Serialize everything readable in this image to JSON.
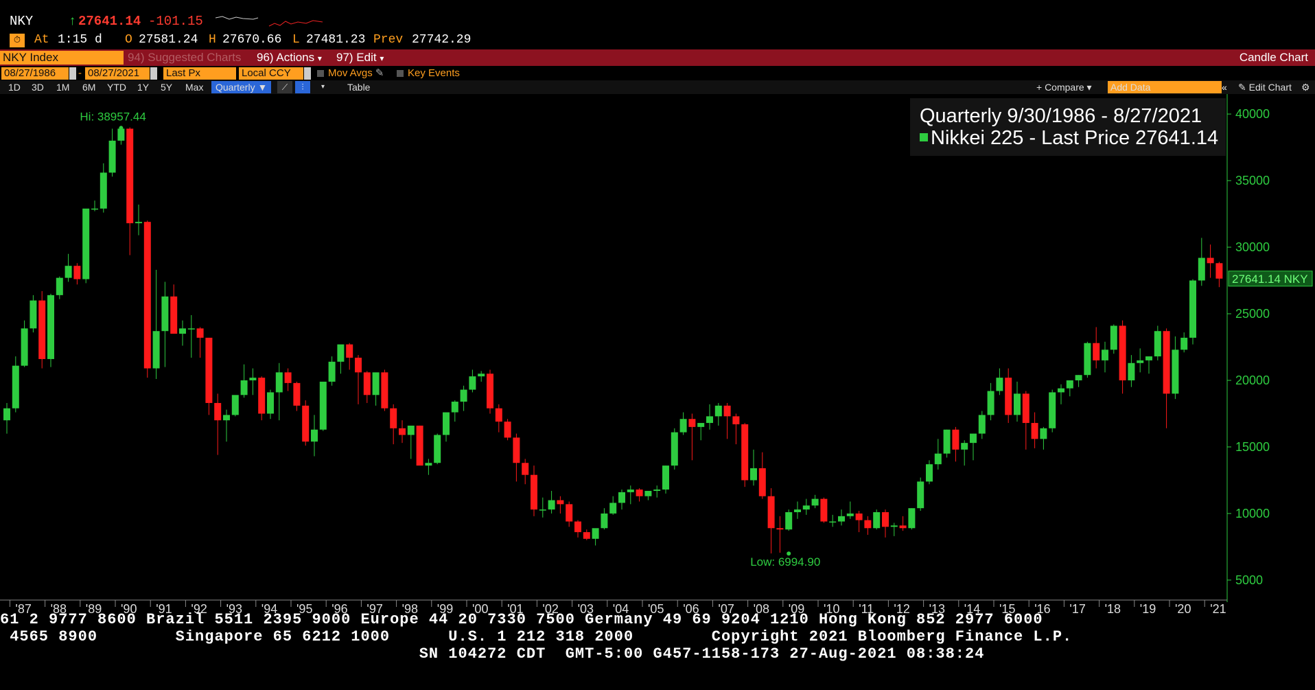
{
  "ticker": {
    "symbol": "NKY",
    "arrow": "↑",
    "last": "27641.14",
    "change": "-101.15",
    "at_label": "At",
    "at_time": "1:15 d",
    "open_label": "O",
    "open": "27581.24",
    "high_label": "H",
    "high": "27670.66",
    "low_label": "L",
    "low": "27481.23",
    "prev_label": "Prev",
    "prev": "27742.29"
  },
  "toolbar": {
    "security": "NKY Index",
    "suggested": "94) Suggested Charts",
    "actions": "96) Actions",
    "edit": "97) Edit",
    "chart_type": "Candle Chart",
    "dropdown_glyph": "▾"
  },
  "daterow": {
    "start": "08/27/1986",
    "end": "08/27/2021",
    "dash": "-",
    "field": "Last Px",
    "currency": "Local CCY",
    "mov_avgs": "Mov Avgs",
    "key_events": "Key Events"
  },
  "periods": {
    "buttons": [
      "1D",
      "3D",
      "1M",
      "6M",
      "YTD",
      "1Y",
      "5Y",
      "Max"
    ],
    "selected": "Quarterly ▼",
    "table": "Table",
    "compare": "+ Compare ▾",
    "add_data_placeholder": "Add Data",
    "edit_chart": "Edit Chart"
  },
  "legend": {
    "line1": "Quarterly 9/30/1986 - 8/27/2021",
    "line2": "Nikkei 225 - Last Price 27641.14"
  },
  "footer": {
    "line1": "61 2 9777 8600 Brazil 5511 2395 9000 Europe 44 20 7330 7500 Germany 49 69 9204 1210 Hong Kong 852 2977 6000",
    "line2": " 4565 8900        Singapore 65 6212 1000      U.S. 1 212 318 2000        Copyright 2021 Bloomberg Finance L.P.",
    "line3": "                                           SN 104272 CDT  GMT-5:00 G457-1158-173 27-Aug-2021 08:38:24"
  },
  "colors": {
    "up": "#2ecc40",
    "down": "#ff1a1a",
    "axis": "#2ecc40"
  },
  "chart_data": {
    "type": "candlestick",
    "series_name": "Nikkei 225 - Last Price",
    "ylim": [
      3500,
      41500
    ],
    "yticks": [
      5000,
      10000,
      15000,
      20000,
      25000,
      30000,
      35000,
      40000
    ],
    "xtick_labels": [
      "'87",
      "'88",
      "'89",
      "'90",
      "'91",
      "'92",
      "'93",
      "'94",
      "'95",
      "'96",
      "'97",
      "'98",
      "'99",
      "'00",
      "'01",
      "'02",
      "'03",
      "'04",
      "'05",
      "'06",
      "'07",
      "'08",
      "'09",
      "'10",
      "'11",
      "'12",
      "'13",
      "'14",
      "'15",
      "'16",
      "'17",
      "'18",
      "'19",
      "'20",
      "'21"
    ],
    "hi_label": "Hi: 38957.44",
    "low_label": "Low: 6994.90",
    "last_label": "27641.14 NKY",
    "last_value": 27641.14,
    "hi_value": 38957.44,
    "low_value": 6994.9,
    "hi_index": 13,
    "low_index": 89,
    "ohlc": [
      [
        17000,
        18300,
        16000,
        17900
      ],
      [
        17900,
        21800,
        17600,
        21100
      ],
      [
        21100,
        24500,
        21000,
        23900
      ],
      [
        23900,
        26400,
        23600,
        26000
      ],
      [
        26000,
        26700,
        20900,
        21600
      ],
      [
        21600,
        26500,
        21000,
        26400
      ],
      [
        26400,
        27800,
        26100,
        27700
      ],
      [
        27700,
        29500,
        27400,
        28600
      ],
      [
        28600,
        28800,
        27200,
        27600
      ],
      [
        27600,
        31900,
        27300,
        32900
      ],
      [
        32900,
        33500,
        32700,
        32900
      ],
      [
        32900,
        36300,
        32600,
        35600
      ],
      [
        35600,
        38900,
        35300,
        38000
      ],
      [
        38000,
        38957,
        37700,
        38900
      ],
      [
        38900,
        39000,
        29400,
        31800
      ],
      [
        31800,
        33200,
        30900,
        31900
      ],
      [
        31900,
        32000,
        20200,
        20900
      ],
      [
        20900,
        28300,
        20100,
        23700
      ],
      [
        23700,
        27400,
        21000,
        26300
      ],
      [
        26300,
        27200,
        24800,
        23500
      ],
      [
        23500,
        24500,
        22600,
        23900
      ],
      [
        23900,
        24900,
        21700,
        23900
      ],
      [
        23900,
        24000,
        21700,
        23200
      ],
      [
        23200,
        23200,
        17400,
        18300
      ],
      [
        18300,
        19000,
        14400,
        17000
      ],
      [
        17000,
        17800,
        15400,
        17400
      ],
      [
        17400,
        18800,
        17300,
        18900
      ],
      [
        18900,
        21200,
        18700,
        20000
      ],
      [
        20000,
        20900,
        18900,
        20200
      ],
      [
        20200,
        20300,
        17000,
        17500
      ],
      [
        17500,
        19300,
        17100,
        19100
      ],
      [
        19100,
        21300,
        17000,
        20600
      ],
      [
        20600,
        20900,
        19200,
        19800
      ],
      [
        19800,
        19900,
        17700,
        18100
      ],
      [
        18100,
        18500,
        15100,
        15400
      ],
      [
        15400,
        17400,
        14300,
        16300
      ],
      [
        16300,
        19000,
        16200,
        19900
      ],
      [
        19900,
        21800,
        19600,
        21400
      ],
      [
        21400,
        22300,
        20500,
        22700
      ],
      [
        22700,
        22800,
        20800,
        21700
      ],
      [
        21700,
        21900,
        18200,
        20600
      ],
      [
        20600,
        20700,
        18300,
        18900
      ],
      [
        18900,
        20000,
        18100,
        20600
      ],
      [
        20600,
        20800,
        17700,
        17900
      ],
      [
        17900,
        18200,
        15200,
        16400
      ],
      [
        16400,
        17000,
        15300,
        15900
      ],
      [
        15900,
        16400,
        14100,
        16600
      ],
      [
        16600,
        16600,
        14600,
        13600
      ],
      [
        13600,
        14100,
        12900,
        13800
      ],
      [
        13800,
        16000,
        13700,
        15900
      ],
      [
        15900,
        17500,
        15400,
        17600
      ],
      [
        17600,
        18500,
        16900,
        18400
      ],
      [
        18400,
        19600,
        17700,
        19300
      ],
      [
        19300,
        20800,
        19100,
        20300
      ],
      [
        20300,
        20700,
        19900,
        20500
      ],
      [
        20500,
        20800,
        17500,
        17900
      ],
      [
        17900,
        18200,
        16100,
        16900
      ],
      [
        16900,
        17100,
        15500,
        15700
      ],
      [
        15700,
        16000,
        12400,
        13800
      ],
      [
        13800,
        14100,
        12200,
        12900
      ],
      [
        12900,
        13600,
        9800,
        10300
      ],
      [
        10300,
        11200,
        9700,
        10300
      ],
      [
        10300,
        11700,
        10000,
        11000
      ],
      [
        11000,
        11300,
        10000,
        10700
      ],
      [
        10700,
        10900,
        9000,
        9400
      ],
      [
        9400,
        9500,
        8200,
        8600
      ],
      [
        8600,
        8800,
        8000,
        8100
      ],
      [
        8100,
        8800,
        7600,
        8900
      ],
      [
        8900,
        10400,
        8800,
        10000
      ],
      [
        10000,
        11300,
        9900,
        10800
      ],
      [
        10800,
        11800,
        10300,
        11600
      ],
      [
        11600,
        12100,
        10700,
        11800
      ],
      [
        11800,
        11900,
        10900,
        11300
      ],
      [
        11300,
        11600,
        11000,
        11700
      ],
      [
        11700,
        12100,
        11200,
        11800
      ],
      [
        11800,
        13600,
        11500,
        13600
      ],
      [
        13600,
        16400,
        13300,
        16100
      ],
      [
        16100,
        17600,
        15900,
        17100
      ],
      [
        17100,
        17500,
        14000,
        16500
      ],
      [
        16500,
        16700,
        15500,
        16800
      ],
      [
        16800,
        18200,
        16300,
        17300
      ],
      [
        17300,
        18300,
        16600,
        18100
      ],
      [
        18100,
        18300,
        15600,
        17300
      ],
      [
        17300,
        17500,
        15200,
        16700
      ],
      [
        16700,
        16800,
        12000,
        12500
      ],
      [
        12500,
        14800,
        12100,
        13400
      ],
      [
        13400,
        14600,
        11100,
        11300
      ],
      [
        11300,
        11900,
        7000,
        8900
      ],
      [
        8900,
        9800,
        7054,
        8800
      ],
      [
        8800,
        10300,
        8700,
        10100
      ],
      [
        10100,
        10900,
        9600,
        10300
      ],
      [
        10300,
        11100,
        9900,
        10600
      ],
      [
        10600,
        11400,
        10400,
        11100
      ],
      [
        11100,
        11200,
        9300,
        9400
      ],
      [
        9400,
        9900,
        9000,
        9400
      ],
      [
        9400,
        10300,
        9100,
        9800
      ],
      [
        9800,
        10900,
        9600,
        10000
      ],
      [
        10000,
        10200,
        8600,
        9500
      ],
      [
        9500,
        9800,
        8400,
        8900
      ],
      [
        8900,
        10300,
        8800,
        10100
      ],
      [
        10100,
        10300,
        8200,
        9000
      ],
      [
        9000,
        9300,
        8300,
        9100
      ],
      [
        9100,
        9800,
        8700,
        8900
      ],
      [
        8900,
        10400,
        8800,
        10400
      ],
      [
        10400,
        12700,
        10200,
        12400
      ],
      [
        12400,
        14000,
        12200,
        13700
      ],
      [
        13700,
        15600,
        13300,
        14500
      ],
      [
        14500,
        16300,
        14200,
        16300
      ],
      [
        16300,
        16500,
        13900,
        14800
      ],
      [
        14800,
        15500,
        13600,
        15300
      ],
      [
        15300,
        16000,
        14000,
        16000
      ],
      [
        16000,
        17700,
        15600,
        17400
      ],
      [
        17400,
        19800,
        17000,
        19200
      ],
      [
        19200,
        20900,
        18900,
        20200
      ],
      [
        20200,
        20900,
        16800,
        17400
      ],
      [
        17400,
        19900,
        16900,
        19000
      ],
      [
        19000,
        19200,
        14800,
        16800
      ],
      [
        16800,
        17600,
        14900,
        15600
      ],
      [
        15600,
        16500,
        14800,
        16400
      ],
      [
        16400,
        19300,
        16100,
        19100
      ],
      [
        19100,
        19700,
        18200,
        19400
      ],
      [
        19400,
        20000,
        18800,
        20000
      ],
      [
        20000,
        20400,
        19500,
        20400
      ],
      [
        20400,
        22900,
        20200,
        22800
      ],
      [
        22800,
        24000,
        20900,
        21500
      ],
      [
        21500,
        22900,
        20600,
        22300
      ],
      [
        22300,
        24200,
        22000,
        24100
      ],
      [
        24100,
        24500,
        19000,
        20000
      ],
      [
        20000,
        21900,
        19500,
        21300
      ],
      [
        21300,
        22400,
        20600,
        21500
      ],
      [
        21500,
        21800,
        20500,
        21800
      ],
      [
        21800,
        24100,
        21500,
        23700
      ],
      [
        23700,
        23900,
        16400,
        19000
      ],
      [
        19000,
        23300,
        18600,
        22300
      ],
      [
        22300,
        23600,
        22100,
        23200
      ],
      [
        23200,
        27600,
        22700,
        27500
      ],
      [
        27500,
        30700,
        27100,
        29200
      ],
      [
        29200,
        30200,
        27700,
        28800
      ],
      [
        28800,
        28900,
        27000,
        27641
      ]
    ]
  }
}
